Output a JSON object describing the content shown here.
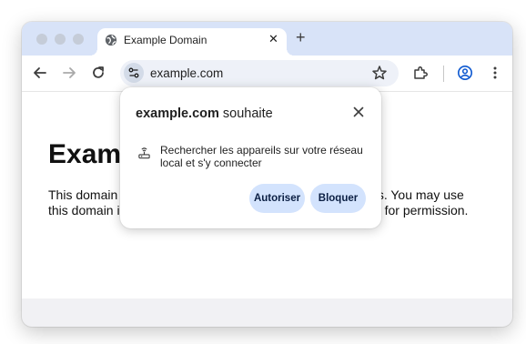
{
  "tab": {
    "title": "Example Domain",
    "close_glyph": "✕"
  },
  "tabstrip": {
    "new_tab_glyph": "+"
  },
  "toolbar": {
    "url": "example.com"
  },
  "page": {
    "heading": "Example Domain",
    "paragraph": "This domain is for use in illustrative examples in documents. You may use this domain in literature without prior coordination or asking for permission."
  },
  "permission_popup": {
    "site": "example.com",
    "title_suffix": " souhaite",
    "request": "Rechercher les appareils sur votre réseau local et s'y connecter",
    "allow_label": "Autoriser",
    "block_label": "Bloquer"
  },
  "colors": {
    "tabstrip": "#d8e3f8",
    "button_bg": "#d3e3fd",
    "accent": "#0b57d0"
  },
  "icons": [
    "globe-icon",
    "back-arrow-icon",
    "forward-arrow-icon",
    "reload-icon",
    "site-info-icon",
    "star-icon",
    "extensions-icon",
    "profile-icon",
    "more-menu-icon",
    "close-icon",
    "router-icon"
  ]
}
